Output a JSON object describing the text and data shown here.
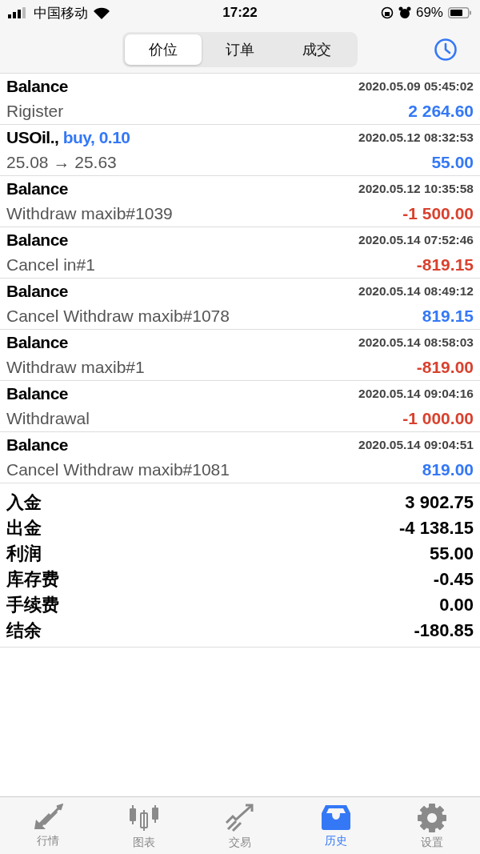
{
  "status_bar": {
    "carrier": "中国移动",
    "time": "17:22",
    "battery": "69%"
  },
  "segments": [
    {
      "label": "价位",
      "selected": true
    },
    {
      "label": "订单",
      "selected": false
    },
    {
      "label": "成交",
      "selected": false
    }
  ],
  "deals": [
    {
      "title": "Balance",
      "time": "2020.05.09 05:45:02",
      "description": "Rigister",
      "amount": "2 264.60",
      "color": "#3478f6"
    },
    {
      "title": "USOil.,",
      "side": "buy, 0.10",
      "time": "2020.05.12 08:32:53",
      "description": "25.08 → 25.63",
      "amount": "55.00",
      "color": "#3478f6"
    },
    {
      "title": "Balance",
      "time": "2020.05.12 10:35:58",
      "description": "Withdraw maxib#1039",
      "amount": "-1 500.00",
      "color": "#d9412e"
    },
    {
      "title": "Balance",
      "time": "2020.05.14 07:52:46",
      "description": "Cancel in#1",
      "amount": "-819.15",
      "color": "#d9412e"
    },
    {
      "title": "Balance",
      "time": "2020.05.14 08:49:12",
      "description": "Cancel Withdraw maxib#1078",
      "amount": "819.15",
      "color": "#3478f6"
    },
    {
      "title": "Balance",
      "time": "2020.05.14 08:58:03",
      "description": "Withdraw maxib#1",
      "amount": "-819.00",
      "color": "#d9412e"
    },
    {
      "title": "Balance",
      "time": "2020.05.14 09:04:16",
      "description": "Withdrawal",
      "amount": "-1 000.00",
      "color": "#d9412e"
    },
    {
      "title": "Balance",
      "time": "2020.05.14 09:04:51",
      "description": "Cancel Withdraw maxib#1081",
      "amount": "819.00",
      "color": "#3478f6"
    }
  ],
  "summary": [
    {
      "label": "入金",
      "value": "3 902.75"
    },
    {
      "label": "出金",
      "value": "-4 138.15"
    },
    {
      "label": "利润",
      "value": "55.00"
    },
    {
      "label": "库存费",
      "value": "-0.45"
    },
    {
      "label": "手续费",
      "value": "0.00"
    },
    {
      "label": "结余",
      "value": "-180.85"
    }
  ],
  "tab_bar": [
    {
      "label": "行情",
      "kind": "quotes",
      "selected": false
    },
    {
      "label": "图表",
      "kind": "chart",
      "selected": false
    },
    {
      "label": "交易",
      "kind": "trade",
      "selected": false
    },
    {
      "label": "历史",
      "kind": "history",
      "selected": true
    },
    {
      "label": "设置",
      "kind": "settings",
      "selected": false
    }
  ]
}
